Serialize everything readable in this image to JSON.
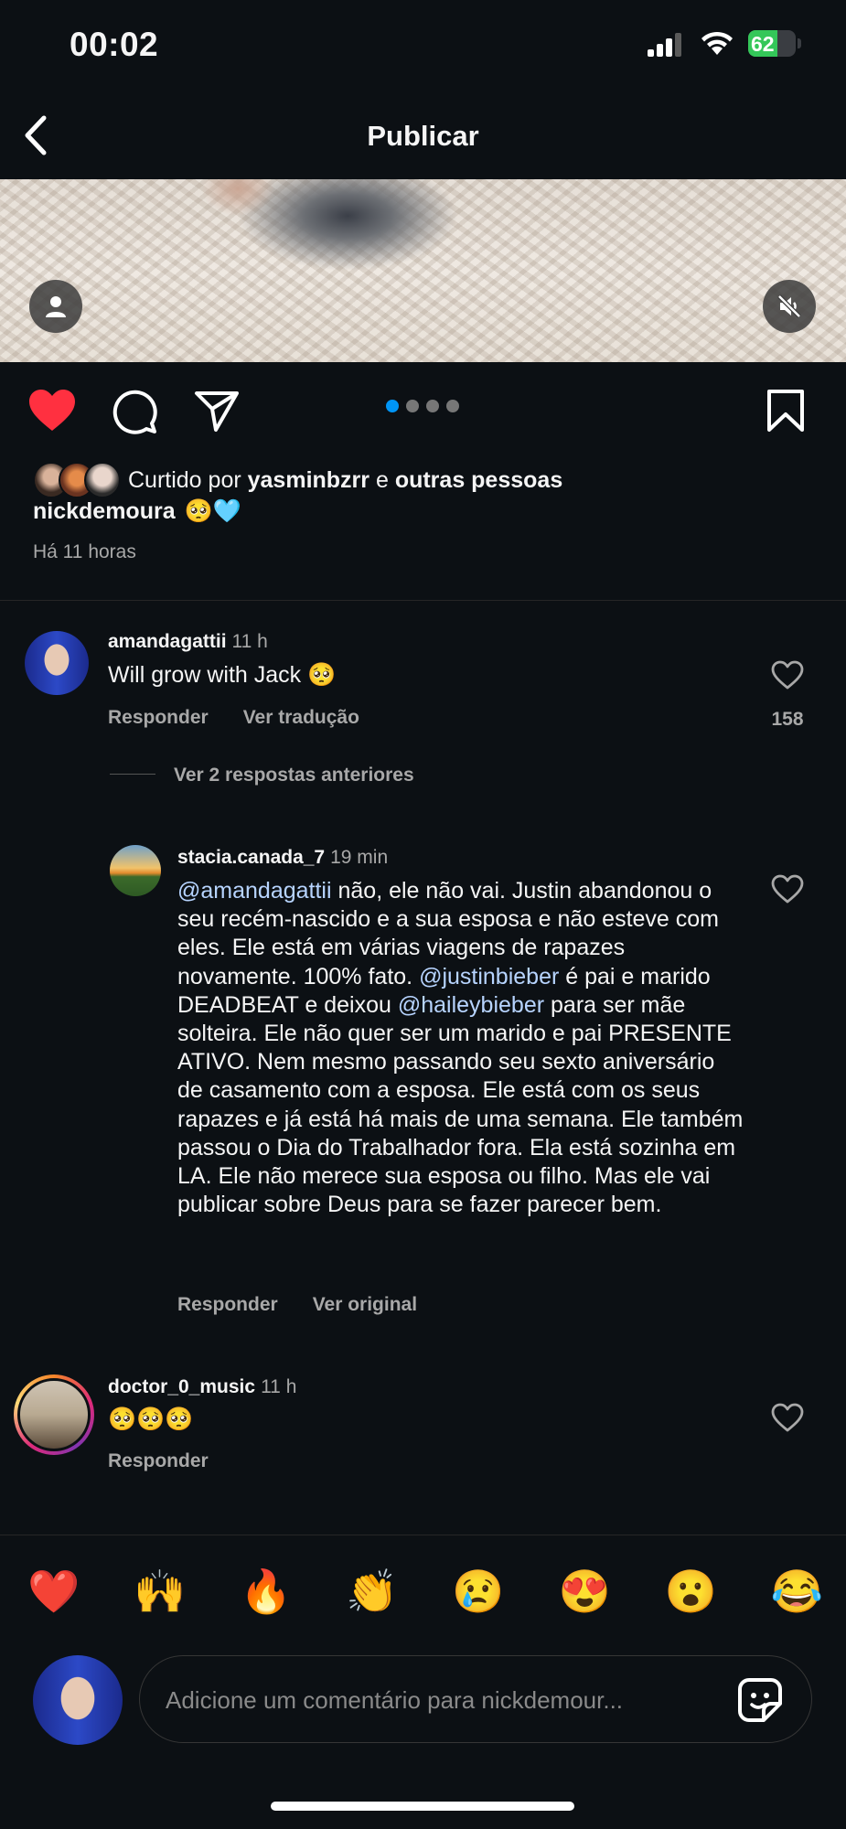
{
  "status_bar": {
    "time": "00:02",
    "battery": "62",
    "battery_level": 0.62
  },
  "header": {
    "title": "Publicar"
  },
  "post": {
    "carousel_active_index": 0,
    "carousel_count": 4,
    "liked_by_prefix": "Curtido por ",
    "liked_by_user": "yasminbzrr",
    "liked_by_conj": " e ",
    "liked_by_others": "outras pessoas",
    "caption_user": "nickdemoura",
    "caption_emojis": "🥺🩵",
    "time_ago": "Há 11 horas"
  },
  "comments": {
    "c1": {
      "user": "amandagattii",
      "time": "11 h",
      "text": "Will grow with Jack 🥺",
      "reply_label": "Responder",
      "translate_label": "Ver tradução",
      "likes": "158"
    },
    "view_replies": "Ver 2 respostas anteriores",
    "reply": {
      "user": "stacia.canada_7",
      "time": "19 min",
      "mention1": "@amandagattii",
      "text1": " não, ele não vai. Justin abandonou o seu recém-nascido e a sua esposa e não esteve com eles. Ele está em várias viagens de rapazes novamente. 100% fato. ",
      "mention2": "@justinbieber",
      "text2": " é pai e marido DEADBEAT e deixou ",
      "mention3": "@haileybieber",
      "text3": " para ser mãe solteira. Ele não quer ser um marido e pai PRESENTE ATIVO. Nem mesmo passando seu sexto aniversário de casamento com a esposa. Ele está com os seus rapazes e já está há mais de uma semana. Ele também passou o Dia do Trabalhador fora. Ela está sozinha em LA. Ele não merece sua esposa ou filho. Mas ele vai publicar sobre Deus para se fazer parecer bem.",
      "reply_label": "Responder",
      "original_label": "Ver original"
    },
    "c3": {
      "user": "doctor_0_music",
      "time": "11 h",
      "text": "🥺🥺🥺",
      "reply_label": "Responder"
    }
  },
  "emoji_bar": [
    "❤️",
    "🙌",
    "🔥",
    "👏",
    "😢",
    "😍",
    "😮",
    "😂"
  ],
  "composer": {
    "placeholder": "Adicione um comentário para nickdemour..."
  },
  "colors": {
    "background": "#0c1014",
    "like_red": "#ff3040",
    "accent_blue": "#0095f6",
    "mention": "#b7d4ff",
    "muted": "#a8a8a8"
  },
  "icons": [
    "back-chevron-icon",
    "user-tag-icon",
    "mute-icon",
    "heart-filled-icon",
    "comment-icon",
    "share-icon",
    "bookmark-icon",
    "heart-outline-icon",
    "sticker-icon"
  ]
}
